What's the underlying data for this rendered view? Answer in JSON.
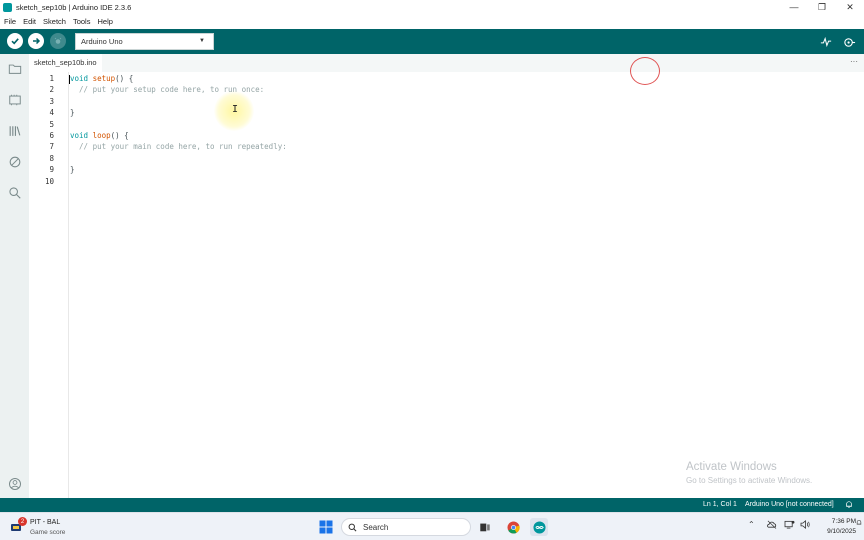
{
  "window": {
    "title": "sketch_sep10b | Arduino IDE 2.3.6",
    "controls": {
      "minimize": "—",
      "restore": "❐",
      "close": "✕"
    }
  },
  "menu": [
    "File",
    "Edit",
    "Sketch",
    "Tools",
    "Help"
  ],
  "toolbar": {
    "board": "Arduino Uno",
    "colors": {
      "toolbar_bg": "#006468",
      "status_bg": "#006468",
      "accent": "#00979d"
    }
  },
  "tabs": [
    {
      "label": "sketch_sep10b.ino"
    }
  ],
  "tab_more": "···",
  "editor": {
    "line_numbers": [
      "1",
      "2",
      "3",
      "4",
      "5",
      "6",
      "7",
      "8",
      "9",
      "10"
    ],
    "lines": [
      {
        "kw": "void",
        "fn": "setup",
        "rest": "() {"
      },
      {
        "comment": "  // put your setup code here, to run once:"
      },
      {
        "text": ""
      },
      {
        "text": "}"
      },
      {
        "text": ""
      },
      {
        "kw": "void",
        "fn": "loop",
        "rest": "() {"
      },
      {
        "comment": "  // put your main code here, to run repeatedly:"
      },
      {
        "text": ""
      },
      {
        "text": "}"
      },
      {
        "text": ""
      }
    ]
  },
  "watermark": {
    "line1": "Activate Windows",
    "line2": "Go to Settings to activate Windows."
  },
  "statusbar": {
    "position": "Ln 1, Col 1",
    "board": "Arduino Uno [not connected]"
  },
  "taskbar": {
    "weather_badge": "2",
    "weather_title": "PIT - BAL",
    "weather_subtitle": "Game score",
    "search_label": "Search",
    "time": "7:36 PM",
    "date": "9/10/2025"
  }
}
